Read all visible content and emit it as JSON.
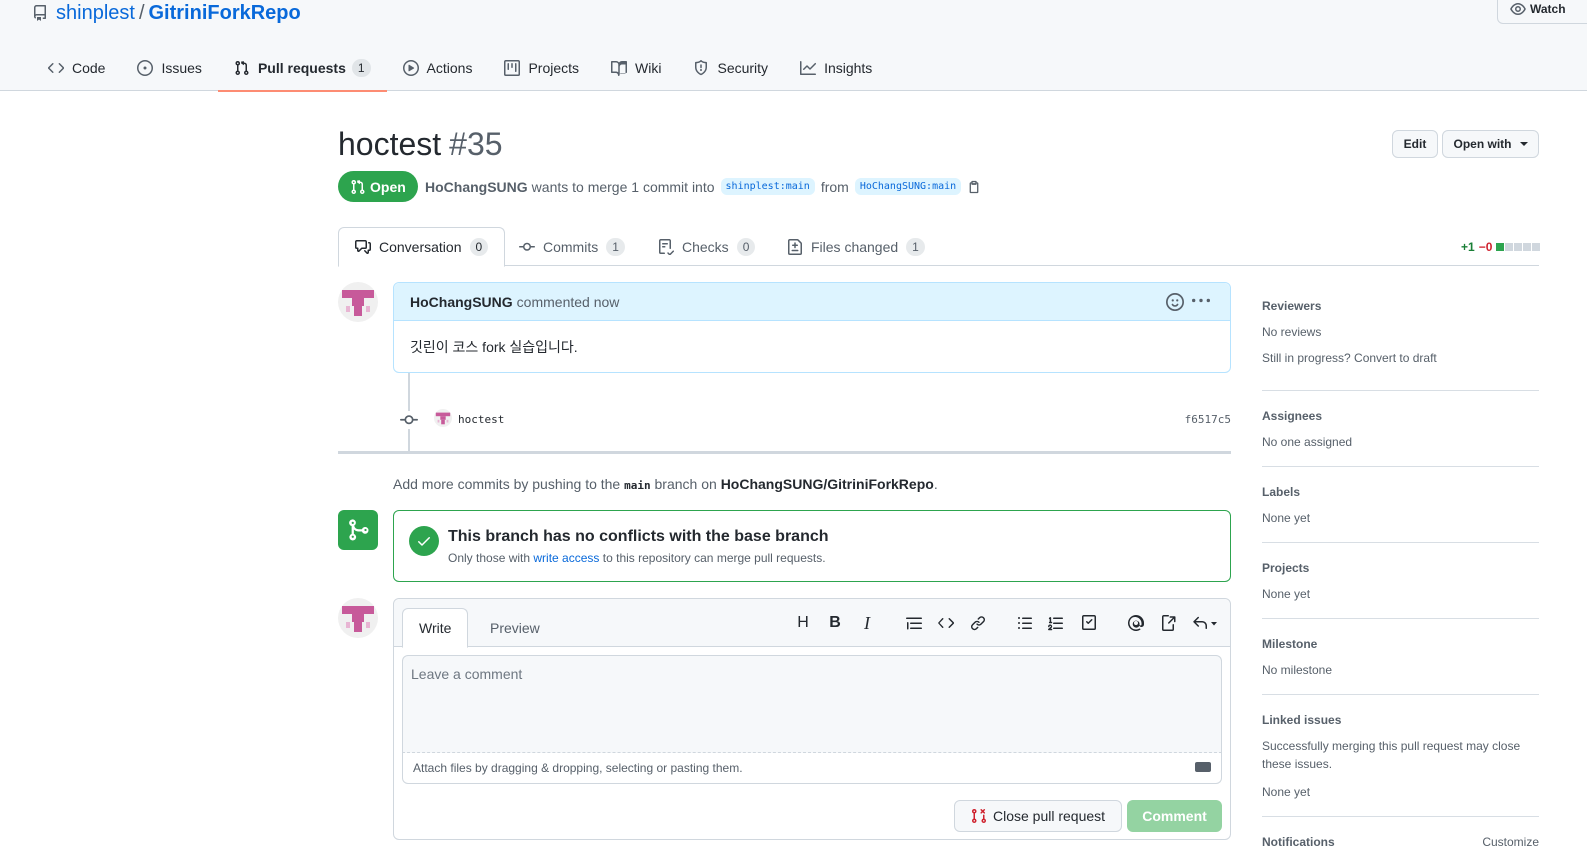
{
  "repo": {
    "owner": "shinplest",
    "name": "GitriniForkRepo",
    "watch_label": "Watch"
  },
  "nav_tabs": [
    {
      "label": "Code",
      "icon": "code-icon"
    },
    {
      "label": "Issues",
      "icon": "issue-icon"
    },
    {
      "label": "Pull requests",
      "icon": "pull-request-icon",
      "count": "1",
      "selected": true
    },
    {
      "label": "Actions",
      "icon": "play-icon"
    },
    {
      "label": "Projects",
      "icon": "project-icon"
    },
    {
      "label": "Wiki",
      "icon": "book-icon"
    },
    {
      "label": "Security",
      "icon": "shield-icon"
    },
    {
      "label": "Insights",
      "icon": "graph-icon"
    }
  ],
  "pr": {
    "title": "hoctest",
    "number": "#35",
    "state": "Open",
    "author": "HoChangSUNG",
    "merge_text": "wants to merge 1 commit into",
    "base_branch": "shinplest:main",
    "from_text": "from",
    "head_branch": "HoChangSUNG:main",
    "edit_label": "Edit",
    "open_with_label": "Open with"
  },
  "pr_tabs": [
    {
      "label": "Conversation",
      "count": "0",
      "icon": "comment-discussion-icon"
    },
    {
      "label": "Commits",
      "count": "1",
      "icon": "commit-icon"
    },
    {
      "label": "Checks",
      "count": "0",
      "icon": "checklist-icon"
    },
    {
      "label": "Files changed",
      "count": "1",
      "icon": "file-diff-icon"
    }
  ],
  "diffstat": {
    "additions": "+1",
    "deletions": "−0"
  },
  "comment": {
    "author": "HoChangSUNG",
    "time_text": "commented now",
    "body": "깃린이 코스 fork 실습입니다."
  },
  "commit": {
    "message": "hoctest",
    "sha": "f6517c5"
  },
  "push_hint": {
    "prefix": "Add more commits by pushing to the",
    "branch": "main",
    "middle": "branch on",
    "repo": "HoChangSUNG/GitriniForkRepo",
    "suffix": "."
  },
  "merge": {
    "title": "This branch has no conflicts with the base branch",
    "sub_prefix": "Only those with",
    "sub_link": "write access",
    "sub_suffix": "to this repository can merge pull requests."
  },
  "form": {
    "write_tab": "Write",
    "preview_tab": "Preview",
    "placeholder": "Leave a comment",
    "attach_text": "Attach files by dragging & dropping, selecting or pasting them.",
    "close_label": "Close pull request",
    "comment_label": "Comment"
  },
  "sidebar": {
    "reviewers": {
      "heading": "Reviewers",
      "value": "No reviews",
      "extra": "Still in progress? Convert to draft"
    },
    "assignees": {
      "heading": "Assignees",
      "value": "No one assigned"
    },
    "labels": {
      "heading": "Labels",
      "value": "None yet"
    },
    "projects": {
      "heading": "Projects",
      "value": "None yet"
    },
    "milestone": {
      "heading": "Milestone",
      "value": "No milestone"
    },
    "linked": {
      "heading": "Linked issues",
      "desc": "Successfully merging this pull request may close these issues.",
      "value": "None yet"
    },
    "notifications": {
      "heading": "Notifications",
      "customize": "Customize"
    }
  },
  "colors": {
    "accent": "#0969da",
    "open_green": "#2da44e",
    "tab_underline": "#fd8c73",
    "danger": "#cf222e"
  }
}
